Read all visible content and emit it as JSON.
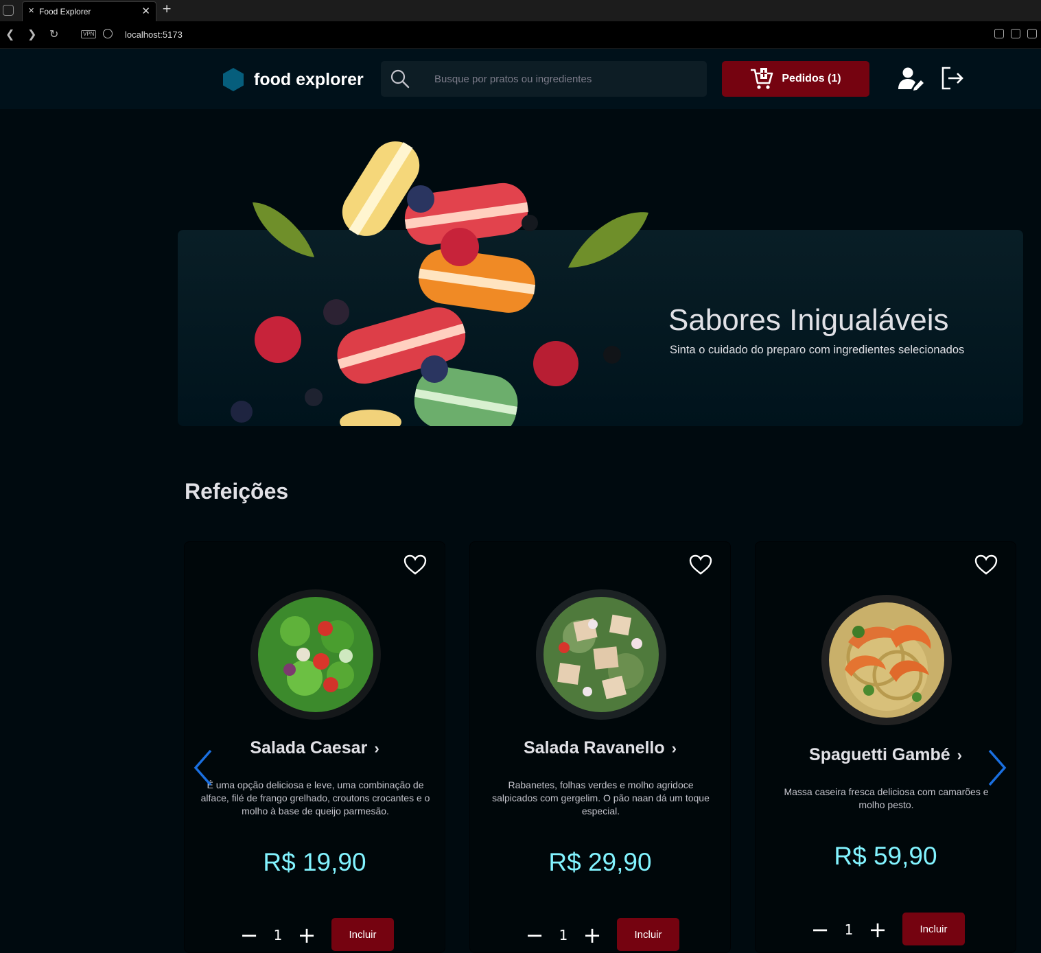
{
  "browser": {
    "tab_title": "Food Explorer",
    "tab_icon": "fork-knife-icon",
    "close_glyph": "✕",
    "new_tab_glyph": "+",
    "vpn_label": "VPN",
    "url": "localhost:5173"
  },
  "header": {
    "brand": "food explorer",
    "search_placeholder": "Busque por pratos ou ingredientes",
    "orders_label": "Pedidos (1)",
    "brand_color": "#065E7C",
    "accent_color": "#750310"
  },
  "banner": {
    "title": "Sabores Inigualáveis",
    "subtitle": "Sinta o cuidado do preparo com ingredientes selecionados"
  },
  "section": {
    "title": "Refeições"
  },
  "dishes": [
    {
      "name": "Salada Caesar",
      "description": "É uma opção deliciosa e leve, uma combinação de alface, filé de frango grelhado, croutons crocantes e o molho à base de queijo parmesão.",
      "price": "R$ 19,90",
      "quantity": "1",
      "add_label": "Incluir"
    },
    {
      "name": "Salada Ravanello",
      "description": "Rabanetes, folhas verdes e molho agridoce salpicados com gergelim. O pão naan dá um toque especial.",
      "price": "R$ 29,90",
      "quantity": "1",
      "add_label": "Incluir"
    },
    {
      "name": "Spaguetti Gambé",
      "description": "Massa caseira fresca deliciosa com camarões e molho pesto.",
      "price": "R$ 59,90",
      "quantity": "1",
      "add_label": "Incluir"
    }
  ],
  "glyphs": {
    "chevron": "›",
    "minus": "−",
    "plus": "+"
  }
}
